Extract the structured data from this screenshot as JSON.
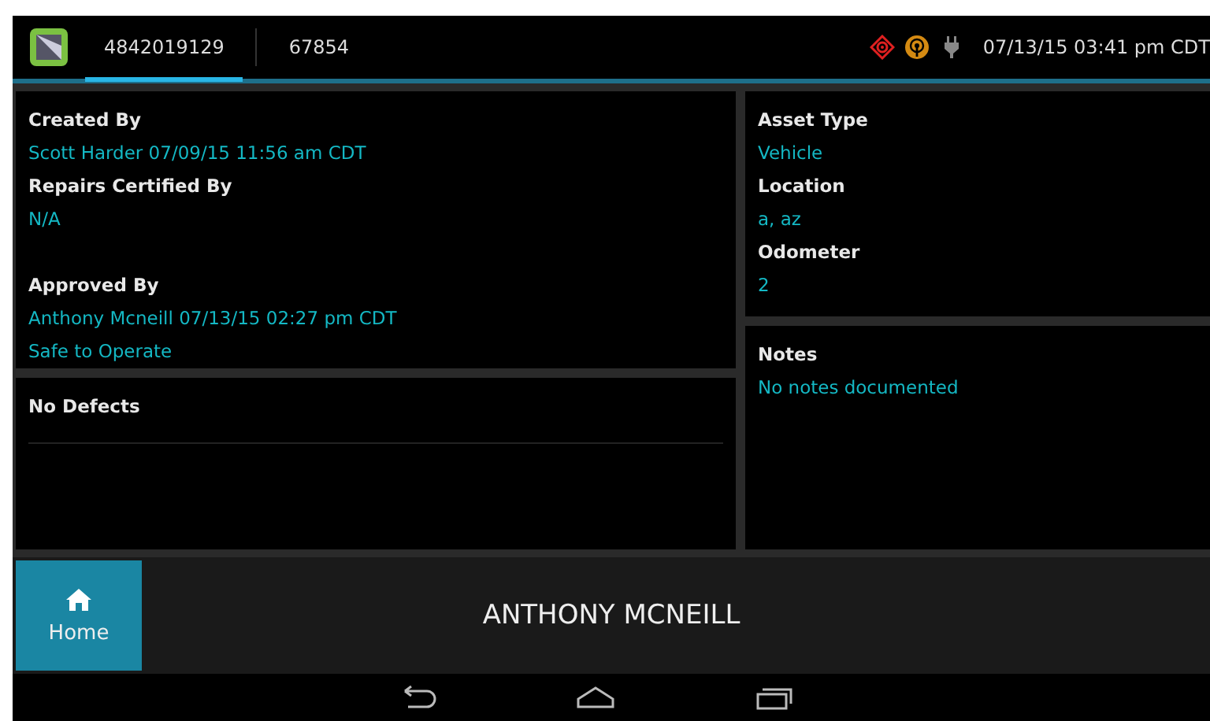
{
  "tabs": [
    {
      "label": "4842019129",
      "selected": true
    },
    {
      "label": "67854",
      "selected": false
    }
  ],
  "status": {
    "datetime": "07/13/15 03:41 pm CDT"
  },
  "inspection": [
    {
      "label": "Created By",
      "value": "Scott Harder 07/09/15 11:56 am CDT"
    },
    {
      "label": "Repairs Certified By",
      "value": "N/A"
    },
    {
      "label": "Approved By",
      "value": "Anthony Mcneill 07/13/15 02:27 pm CDT",
      "note": "Safe to Operate"
    }
  ],
  "defects": {
    "title": "No Defects"
  },
  "asset": [
    {
      "label": "Asset Type",
      "value": "Vehicle"
    },
    {
      "label": "Location",
      "value": "a, az"
    },
    {
      "label": "Odometer",
      "value": "2"
    }
  ],
  "notes": {
    "label": "Notes",
    "value": "No notes documented"
  },
  "bottom_bar": {
    "home_label": "Home",
    "user_name": "ANTHONY MCNEILL"
  }
}
